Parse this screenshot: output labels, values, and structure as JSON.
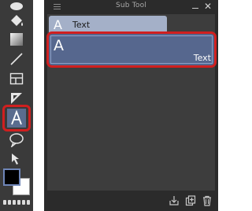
{
  "toolbar": {
    "tools": [
      {
        "name": "eyedropper"
      },
      {
        "name": "fill"
      },
      {
        "name": "gradient"
      },
      {
        "name": "figure-line"
      },
      {
        "name": "frame-border"
      },
      {
        "name": "ruler"
      },
      {
        "name": "text",
        "selected": true
      },
      {
        "name": "balloon"
      },
      {
        "name": "correct-line"
      }
    ],
    "main_color": "#000000",
    "sub_color": "#ffffff"
  },
  "subtool_panel": {
    "title": "Sub Tool",
    "group_tab": {
      "icon": "A",
      "label": "Text"
    },
    "items": [
      {
        "icon": "A",
        "label": "Text",
        "selected": true
      }
    ],
    "footer_icons": [
      "copy-to-file-icon",
      "duplicate-subtool-icon",
      "delete-subtool-icon"
    ]
  },
  "colors": {
    "highlight": "#d01f1f",
    "selected_item": "#56678e",
    "group_tab": "#a4b0c8",
    "panel_bg": "#3d3d3d"
  }
}
